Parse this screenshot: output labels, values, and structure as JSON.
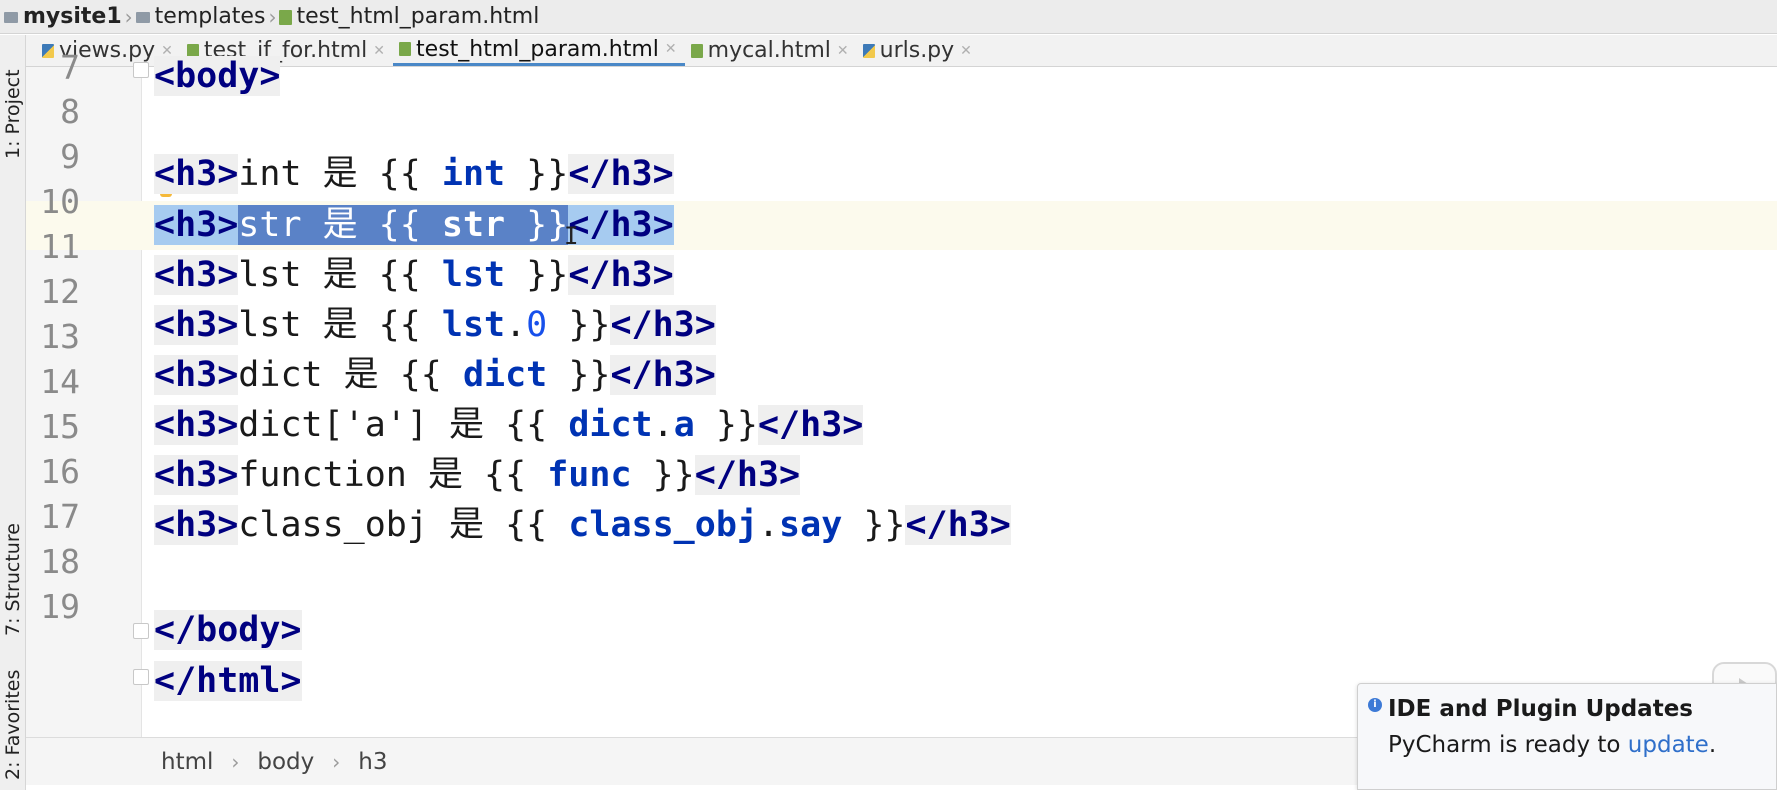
{
  "navbar": {
    "project": "mysite1",
    "folder": "templates",
    "file": "test_html_param.html"
  },
  "tabs": [
    {
      "label": "views.py",
      "type": "py",
      "active": false
    },
    {
      "label": "test_if_for.html",
      "type": "html",
      "active": false
    },
    {
      "label": "test_html_param.html",
      "type": "html",
      "active": true
    },
    {
      "label": "mycal.html",
      "type": "html",
      "active": false
    },
    {
      "label": "urls.py",
      "type": "py",
      "active": false
    }
  ],
  "tool_windows": {
    "project": "1: Project",
    "structure": "7: Structure",
    "favorites": "2: Favorites"
  },
  "editor": {
    "line_numbers": [
      "7",
      "8",
      "9",
      "10",
      "11",
      "12",
      "13",
      "14",
      "15",
      "16",
      "17",
      "18",
      "19"
    ],
    "code": {
      "l7": {
        "tag": "<body>"
      },
      "l9": {
        "open": "<h3>",
        "text": "int 是 {{ ",
        "var": "int",
        "tail": " }}",
        "close": "</h3>"
      },
      "l10": {
        "open": "<h3>",
        "text": "str 是 {{ ",
        "var": "str",
        "tail": " }}",
        "close": "</h3>"
      },
      "l11": {
        "open": "<h3>",
        "text": "lst 是 {{ ",
        "var": "lst",
        "tail": " }}",
        "close": "</h3>"
      },
      "l12": {
        "open": "<h3>",
        "text": "lst 是 {{ ",
        "var": "lst",
        "dot": ".",
        "num": "0",
        "tail": " }}",
        "close": "</h3>"
      },
      "l13": {
        "open": "<h3>",
        "text": "dict 是 {{ ",
        "var": "dict",
        "tail": " }}",
        "close": "</h3>"
      },
      "l14": {
        "open": "<h3>",
        "text": "dict['a'] 是 {{ ",
        "var": "dict",
        "dot": ".",
        "attr": "a",
        "tail": " }}",
        "close": "</h3>"
      },
      "l15": {
        "open": "<h3>",
        "text": "function 是 {{ ",
        "var": "func",
        "tail": " }}",
        "close": "</h3>"
      },
      "l16": {
        "open": "<h3>",
        "text": "class_obj 是 {{ ",
        "var": "class_obj",
        "dot": ".",
        "attr": "say",
        "tail": " }}",
        "close": "</h3>"
      },
      "l18": {
        "tag": "</body>"
      },
      "l19": {
        "tag": "</html>"
      }
    }
  },
  "breadcrumb": [
    "html",
    "body",
    "h3"
  ],
  "notification": {
    "title": "IDE and Plugin Updates",
    "body_prefix": "PyCharm is ready to ",
    "link": "update",
    "body_suffix": "."
  },
  "colors": {
    "tag": "#000080",
    "variable": "#0033b3",
    "number": "#1750eb",
    "selection": "#a6cbf0",
    "selection_strong": "#5a82c7",
    "current_line": "#fcfaed",
    "link": "#2f6fca"
  },
  "icons": [
    "folder-icon",
    "html-file-icon",
    "python-file-icon",
    "close-icon",
    "info-icon",
    "lightbulb-icon",
    "fold-icon",
    "play-icon"
  ]
}
